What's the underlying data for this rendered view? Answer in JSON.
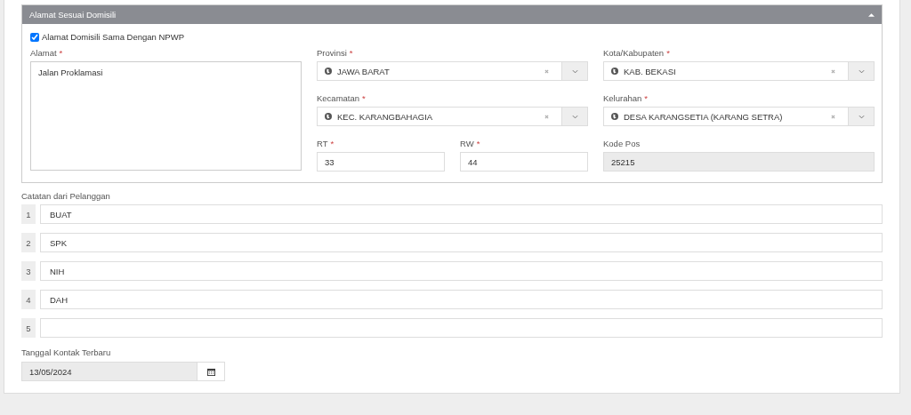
{
  "panel": {
    "title": "Alamat Sesuai Domisili",
    "expanded": true
  },
  "same_as_npwp": {
    "label": "Alamat Domisili Sama Dengan NPWP",
    "checked": true
  },
  "address": {
    "label": "Alamat",
    "required_mark": "*",
    "value": "Jalan Proklamasi"
  },
  "selects": [
    {
      "label": "Provinsi",
      "required_mark": "*",
      "value": "JAWA BARAT"
    },
    {
      "label": "Kota/Kabupaten",
      "required_mark": "*",
      "value": "KAB. BEKASI"
    },
    {
      "label": "Kecamatan",
      "required_mark": "*",
      "value": "KEC. KARANGBAHAGIA"
    },
    {
      "label": "Kelurahan",
      "required_mark": "*",
      "value": "DESA KARANGSETIA (KARANG SETRA)"
    }
  ],
  "rt": {
    "label": "RT",
    "required_mark": "*",
    "value": "33"
  },
  "rw": {
    "label": "RW",
    "required_mark": "*",
    "value": "44"
  },
  "postal_code": {
    "label": "Kode Pos",
    "value": "25215",
    "disabled": true
  },
  "notes": {
    "label": "Catatan dari Pelanggan",
    "rows": [
      {
        "number": "1",
        "value": "BUAT"
      },
      {
        "number": "2",
        "value": "SPK"
      },
      {
        "number": "3",
        "value": "NIH"
      },
      {
        "number": "4",
        "value": "DAH"
      },
      {
        "number": "5"
      }
    ]
  },
  "last_contact": {
    "label": "Tanggal Kontak Terbaru",
    "value": "13/05/2024",
    "disabled": true
  }
}
